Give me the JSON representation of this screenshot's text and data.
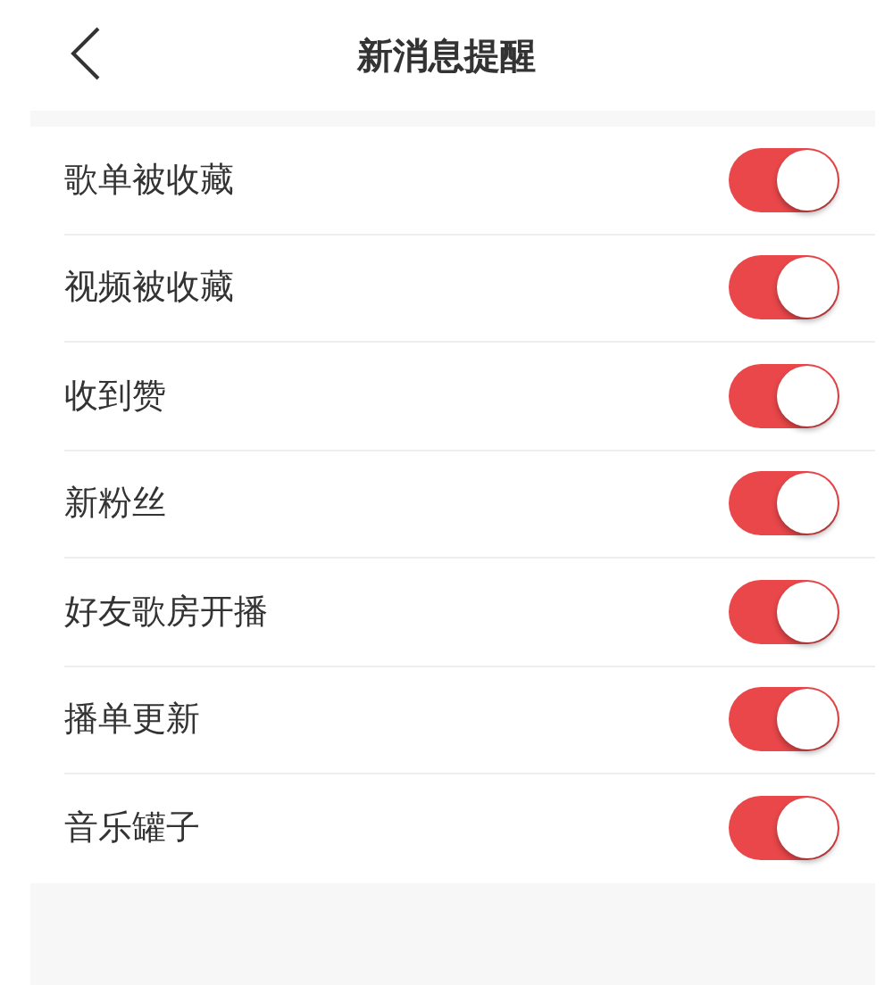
{
  "header": {
    "title": "新消息提醒"
  },
  "settings": [
    {
      "label": "歌单被收藏",
      "on": true
    },
    {
      "label": "视频被收藏",
      "on": true
    },
    {
      "label": "收到赞",
      "on": true
    },
    {
      "label": "新粉丝",
      "on": true
    },
    {
      "label": "好友歌房开播",
      "on": true
    },
    {
      "label": "播单更新",
      "on": true
    },
    {
      "label": "音乐罐子",
      "on": true
    }
  ]
}
